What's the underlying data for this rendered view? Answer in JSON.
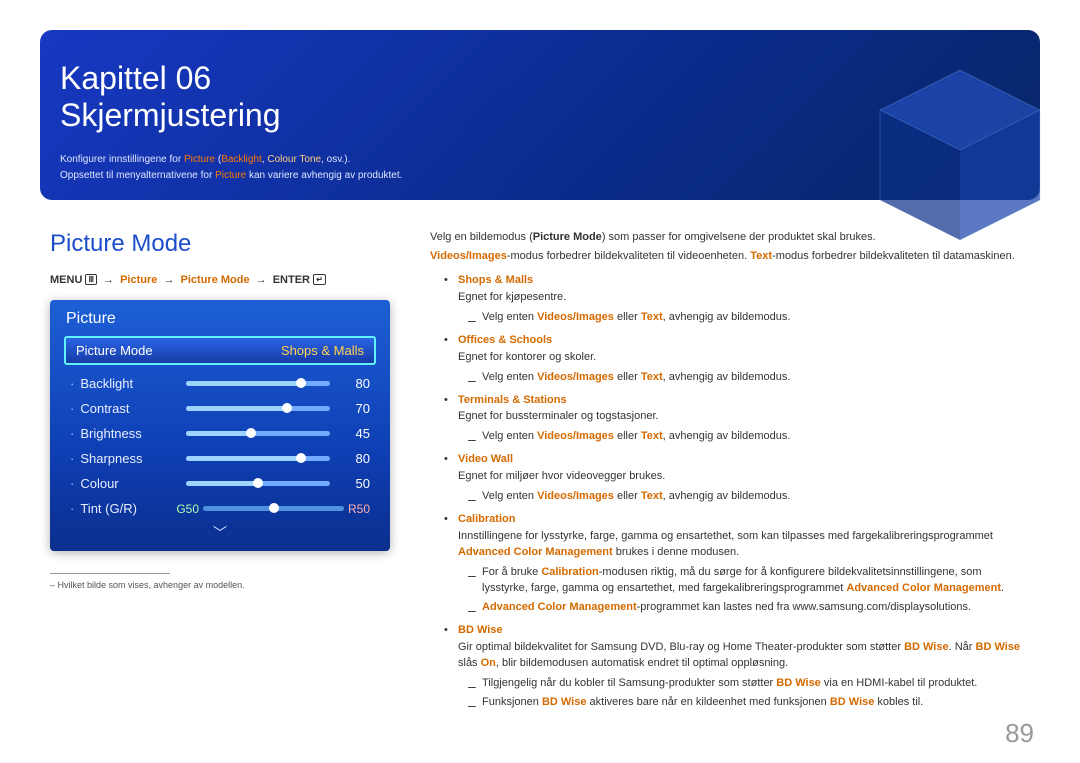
{
  "chapter": {
    "kapittel": "Kapittel 06",
    "title": "Skjermjustering"
  },
  "header_sub": {
    "line1_pre": "Konfigurer innstillingene for ",
    "picture": "Picture",
    "paren_open": " (",
    "backlight": "Backlight",
    "comma": ", ",
    "colour_tone": "Colour Tone",
    "line1_post": ", osv.).",
    "line2_pre": "Oppsettet til menyalternativene for ",
    "line2_post": " kan variere avhengig av produktet."
  },
  "section_title": "Picture Mode",
  "breadcrumb": {
    "menu": "MENU",
    "picture": "Picture",
    "pm": "Picture Mode",
    "enter": "ENTER"
  },
  "panel": {
    "title": "Picture",
    "selected_label": "Picture Mode",
    "selected_value": "Shops & Malls",
    "items": [
      {
        "label": "Backlight",
        "value": 80,
        "pct": 80
      },
      {
        "label": "Contrast",
        "value": 70,
        "pct": 70
      },
      {
        "label": "Brightness",
        "value": 45,
        "pct": 45
      },
      {
        "label": "Sharpness",
        "value": 80,
        "pct": 80
      },
      {
        "label": "Colour",
        "value": 50,
        "pct": 50
      }
    ],
    "tint": {
      "label": "Tint (G/R)",
      "g": "G50",
      "r": "R50"
    }
  },
  "footnote": "Hvilket bilde som vises, avhenger av modellen.",
  "right": {
    "lead1_a": "Velg en bildemodus (",
    "lead1_b": "Picture Mode",
    "lead1_c": ") som passer for omgivelsene der produktet skal brukes.",
    "lead2_a": "Videos/Images",
    "lead2_b": "-modus forbedrer bildekvaliteten til videoenheten. ",
    "lead2_c": "Text",
    "lead2_d": "-modus forbedrer bildekvaliteten til datamaskinen.",
    "modes": [
      {
        "name": "Shops & Malls",
        "desc": "Egnet for kjøpesentre.",
        "sub": [
          "Velg enten <b>Videos/Images</b> eller <b>Text</b>, avhengig av bildemodus."
        ]
      },
      {
        "name": "Offices & Schools",
        "desc": "Egnet for kontorer og skoler.",
        "sub": [
          "Velg enten <b>Videos/Images</b> eller <b>Text</b>, avhengig av bildemodus."
        ]
      },
      {
        "name": "Terminals & Stations",
        "desc": "Egnet for bussterminaler og togstasjoner.",
        "sub": [
          "Velg enten <b>Videos/Images</b> eller <b>Text</b>, avhengig av bildemodus."
        ]
      },
      {
        "name": "Video Wall",
        "desc": "Egnet for miljøer hvor videovegger brukes.",
        "sub": [
          "Velg enten <b>Videos/Images</b> eller <b>Text</b>, avhengig av bildemodus."
        ]
      },
      {
        "name": "Calibration",
        "desc": "Innstillingene for lysstyrke, farge, gamma og ensartethet, som kan tilpasses med fargekalibreringsprogrammet <b>Advanced Color Management</b> brukes i denne modusen.",
        "sub": [
          "For å bruke <b>Calibration</b>-modusen riktig, må du sørge for å konfigurere bildekvalitetsinnstillingene, som lysstyrke, farge, gamma og ensartethet, med fargekalibreringsprogrammet <b>Advanced Color Management</b>.",
          "<b>Advanced Color Management</b>-programmet kan lastes ned fra www.samsung.com/displaysolutions."
        ]
      },
      {
        "name": "BD Wise",
        "desc": "Gir optimal bildekvalitet for Samsung DVD, Blu-ray og Home Theater-produkter som støtter <b>BD Wise</b>. Når <b>BD Wise</b> slås <b>On</b>, blir bildemodusen automatisk endret til optimal oppløsning.",
        "sub": [
          "Tilgjengelig når du kobler til Samsung-produkter som støtter <b>BD Wise</b> via en HDMI-kabel til produktet.",
          "Funksjonen <b>BD Wise</b> aktiveres bare når en kildeenhet med funksjonen <b>BD Wise</b> kobles til."
        ]
      }
    ]
  },
  "page_number": "89"
}
